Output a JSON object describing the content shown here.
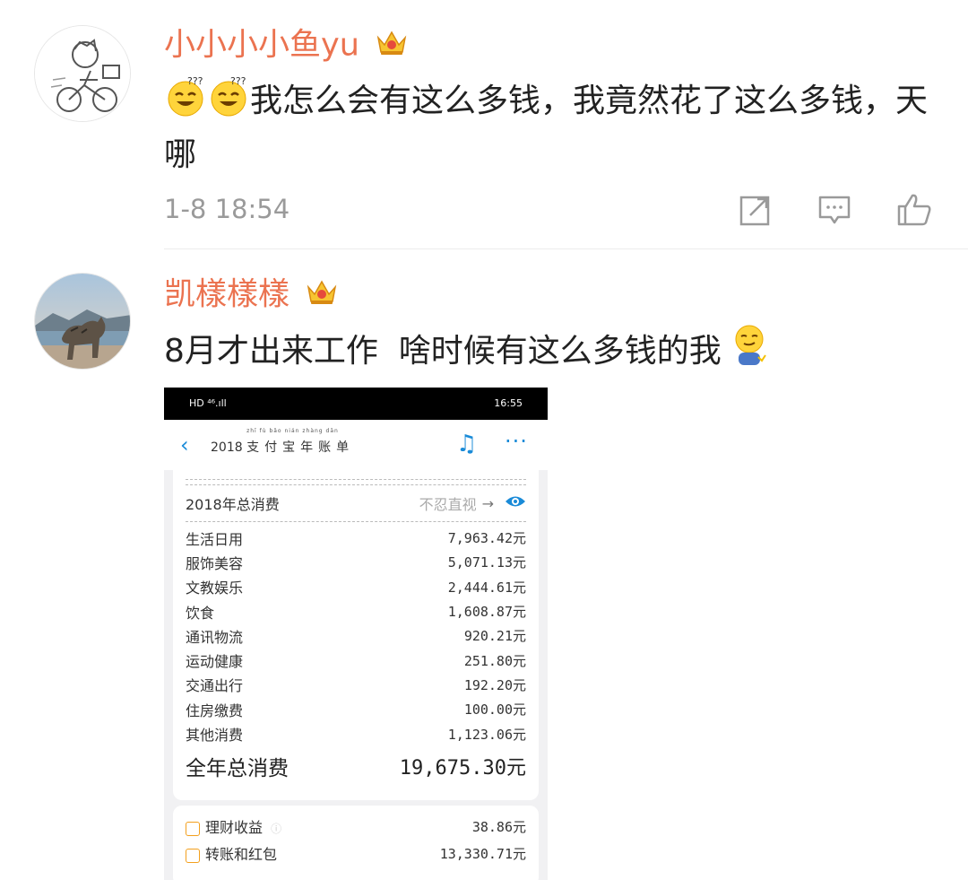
{
  "comments": [
    {
      "username": "小小小小鱼yu",
      "text_prefix_emojis": [
        "squint-grin-emoji",
        "squint-grin-emoji"
      ],
      "text": "我怎么会有这么多钱，我竟然花了这么多钱，天哪",
      "timestamp": "1-8 18:54",
      "actions": [
        "repost-icon",
        "comment-icon",
        "like-icon"
      ]
    },
    {
      "username": "凯樣樣樣",
      "text": "8月才出来工作  啥时候有这么多钱的我",
      "text_suffix_emoji": "awkward-smile-emoji",
      "screenshot": {
        "status_left": "HD ⁴⁶.ıll",
        "status_right": "16:55",
        "title_year": "2018",
        "title_text": "支付宝年账单",
        "title_pinyin": "zhī fù bǎo nián zhàng dān",
        "summary_label": "2018年总消费",
        "summary_hint": "不忍直视",
        "summary_arrow": "→",
        "categories": [
          {
            "label": "生活日用",
            "value": "7,963.42元"
          },
          {
            "label": "服饰美容",
            "value": "5,071.13元"
          },
          {
            "label": "文教娱乐",
            "value": "2,444.61元"
          },
          {
            "label": "饮食",
            "value": "1,608.87元"
          },
          {
            "label": "通讯物流",
            "value": "920.21元"
          },
          {
            "label": "运动健康",
            "value": "251.80元"
          },
          {
            "label": "交通出行",
            "value": "192.20元"
          },
          {
            "label": "住房缴费",
            "value": "100.00元"
          },
          {
            "label": "其他消费",
            "value": "1,123.06元"
          }
        ],
        "total_label": "全年总消费",
        "total_value": "19,675.30元",
        "income_rows": [
          {
            "label": "理财收益",
            "value": "38.86元",
            "info": "ⓘ"
          },
          {
            "label": "转账和红包",
            "value": "13,330.71元"
          }
        ]
      }
    }
  ],
  "colors": {
    "username": "#eb7350",
    "accent_blue": "#1a8bd8",
    "timestamp": "#9a9a9a"
  }
}
